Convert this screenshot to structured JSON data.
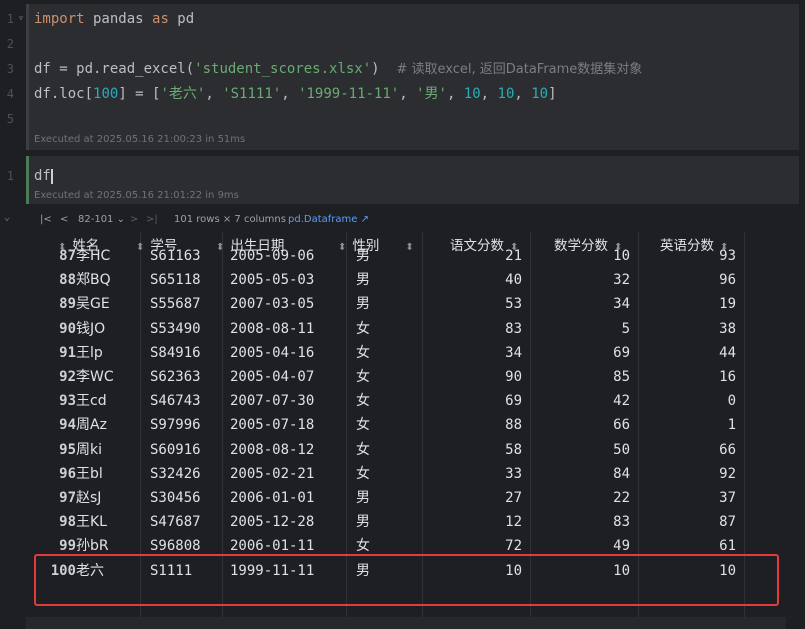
{
  "code_cell": {
    "line_numbers": [
      "1",
      "2",
      "3",
      "4",
      "5"
    ],
    "line1": {
      "kw1": "import",
      "mid": " pandas ",
      "kw2": "as",
      "end": " pd"
    },
    "line3": {
      "a": "df = pd.read_excel(",
      "str": "'student_scores.xlsx'",
      "b": ")  ",
      "cmt": "# 读取excel, 返回DataFrame数据集对象"
    },
    "line4": {
      "a": "df.loc[",
      "n": "100",
      "b": "] = [",
      "s1": "'老六'",
      ", ": ", ",
      "s2": "'S1111'",
      "s3": "'1999-11-11'",
      "s4": "'男'",
      "v1": "10",
      "v2": "10",
      "v3": "10",
      "end": "]"
    },
    "executed": "Executed at 2025.05.16 21:00:23 in 51ms"
  },
  "code_cell2": {
    "line_number": "1",
    "code": "df",
    "executed": "Executed at 2025.05.16 21:01:22 in 9ms"
  },
  "toolbar": {
    "first": "|<",
    "prev": "<",
    "range": "82-101 ⌄",
    "next": ">",
    "last": ">|",
    "info": "101 rows × 7 columns",
    "link": "pd.Dataframe ↗"
  },
  "table": {
    "columns": [
      "姓名",
      "学号",
      "出生日期",
      "性别",
      "语文分数",
      "数学分数",
      "英语分数"
    ],
    "rows": [
      {
        "idx": "87",
        "name": "李HC",
        "sid": "S61163",
        "dob": "2005-09-06",
        "sex": "男",
        "c": "21",
        "m": "10",
        "e": "93"
      },
      {
        "idx": "88",
        "name": "郑BQ",
        "sid": "S65118",
        "dob": "2005-05-03",
        "sex": "男",
        "c": "40",
        "m": "32",
        "e": "96"
      },
      {
        "idx": "89",
        "name": "吴GE",
        "sid": "S55687",
        "dob": "2007-03-05",
        "sex": "男",
        "c": "53",
        "m": "34",
        "e": "19"
      },
      {
        "idx": "90",
        "name": "钱JO",
        "sid": "S53490",
        "dob": "2008-08-11",
        "sex": "女",
        "c": "83",
        "m": "5",
        "e": "38"
      },
      {
        "idx": "91",
        "name": "王lp",
        "sid": "S84916",
        "dob": "2005-04-16",
        "sex": "女",
        "c": "34",
        "m": "69",
        "e": "44"
      },
      {
        "idx": "92",
        "name": "李WC",
        "sid": "S62363",
        "dob": "2005-04-07",
        "sex": "女",
        "c": "90",
        "m": "85",
        "e": "16"
      },
      {
        "idx": "93",
        "name": "王cd",
        "sid": "S46743",
        "dob": "2007-07-30",
        "sex": "女",
        "c": "69",
        "m": "42",
        "e": "0"
      },
      {
        "idx": "94",
        "name": "周Az",
        "sid": "S97996",
        "dob": "2005-07-18",
        "sex": "女",
        "c": "88",
        "m": "66",
        "e": "1"
      },
      {
        "idx": "95",
        "name": "周ki",
        "sid": "S60916",
        "dob": "2008-08-12",
        "sex": "女",
        "c": "58",
        "m": "50",
        "e": "66"
      },
      {
        "idx": "96",
        "name": "王bl",
        "sid": "S32426",
        "dob": "2005-02-21",
        "sex": "女",
        "c": "33",
        "m": "84",
        "e": "92"
      },
      {
        "idx": "97",
        "name": "赵sJ",
        "sid": "S30456",
        "dob": "2006-01-01",
        "sex": "男",
        "c": "27",
        "m": "22",
        "e": "37"
      },
      {
        "idx": "98",
        "name": "王KL",
        "sid": "S47687",
        "dob": "2005-12-28",
        "sex": "男",
        "c": "12",
        "m": "83",
        "e": "87"
      },
      {
        "idx": "99",
        "name": "孙bR",
        "sid": "S96808",
        "dob": "2006-01-11",
        "sex": "女",
        "c": "72",
        "m": "49",
        "e": "61"
      },
      {
        "idx": "100",
        "name": "老六",
        "sid": "S1111",
        "dob": "1999-11-11",
        "sex": "男",
        "c": "10",
        "m": "10",
        "e": "10"
      }
    ]
  },
  "colors": {
    "highlight": "#e23b3b",
    "link": "#589df6",
    "keyword": "#cf8e6d",
    "string": "#6aab73",
    "number": "#2aacb8"
  }
}
